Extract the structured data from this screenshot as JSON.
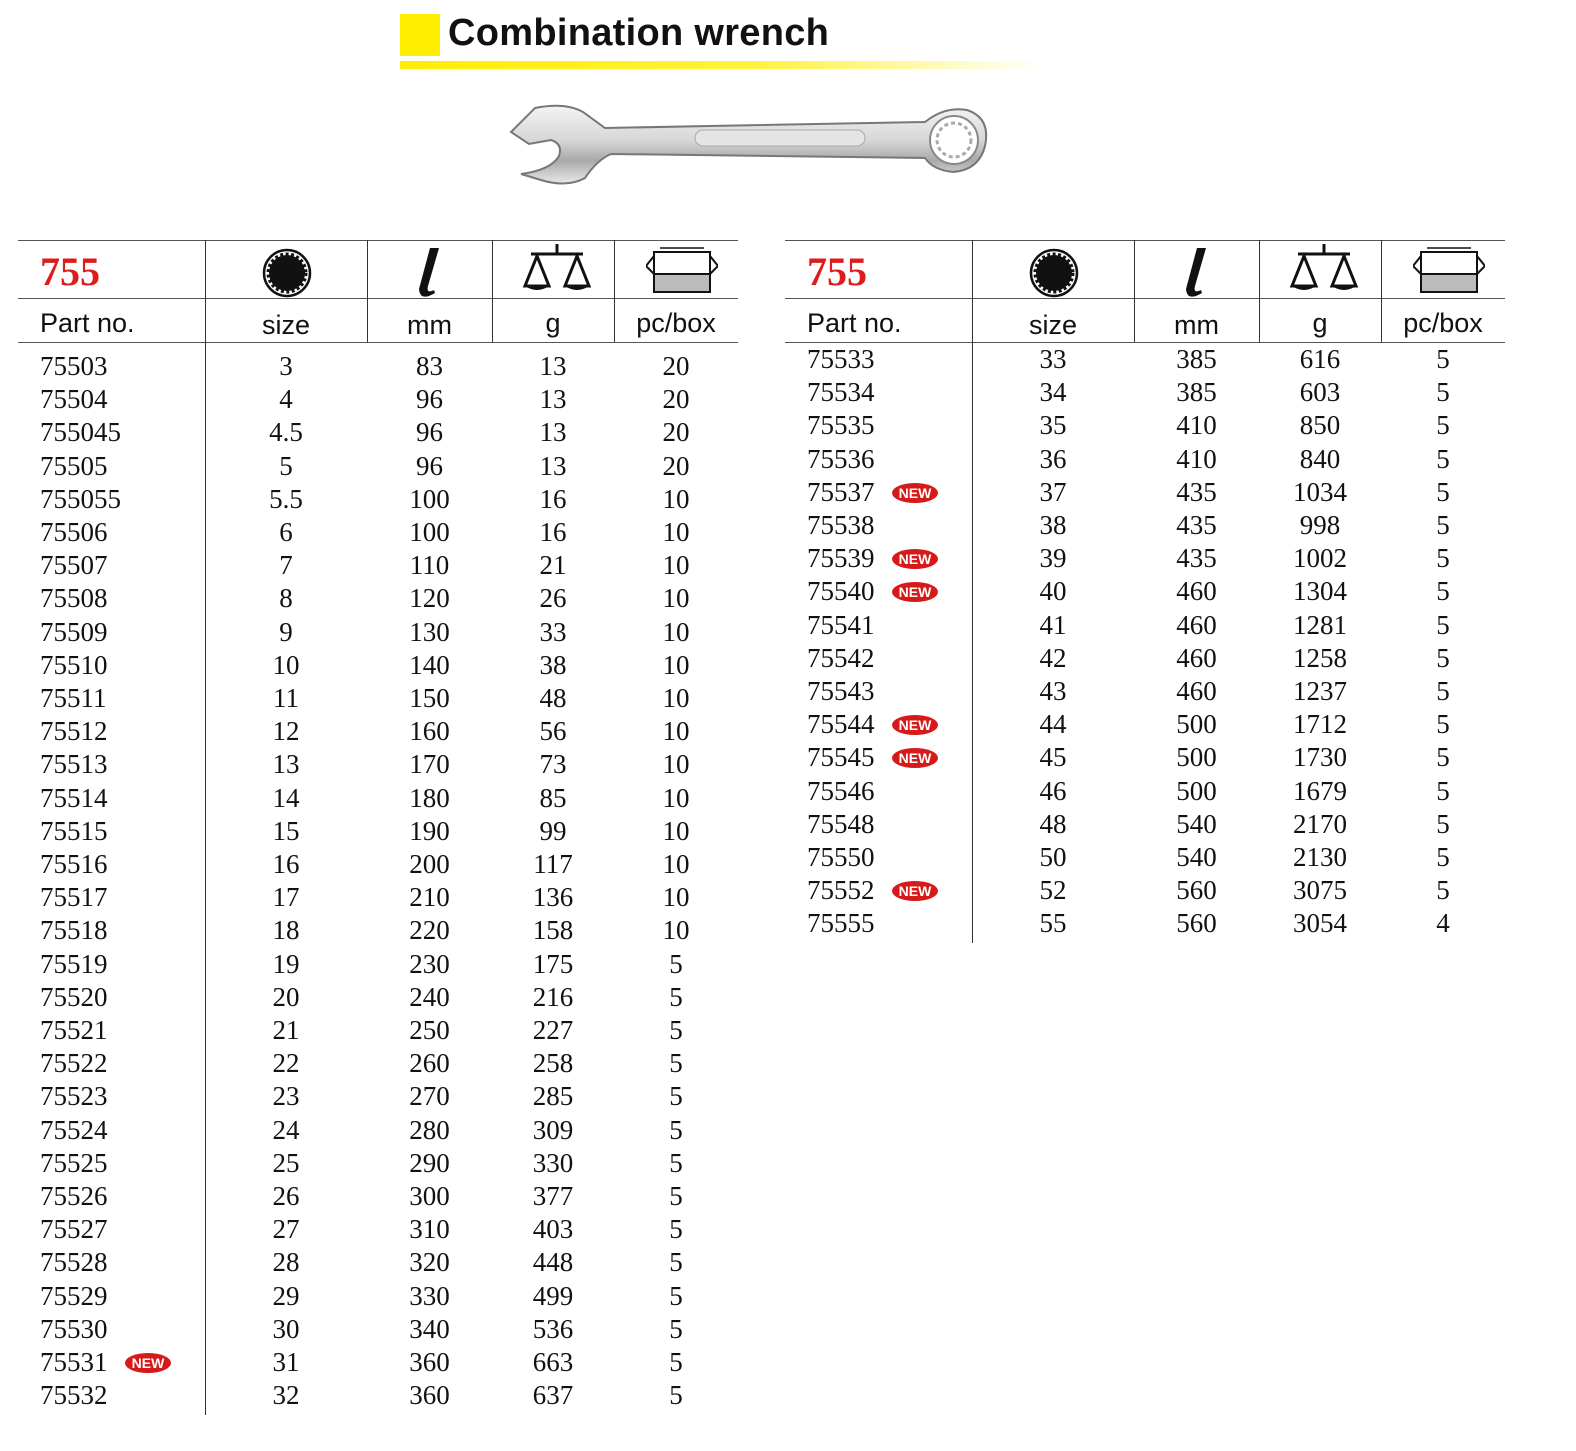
{
  "title": "Combination wrench",
  "series": "755",
  "icons": [
    "twelve-point-ring-icon",
    "length-icon",
    "scale-icon",
    "box-icon"
  ],
  "headers": {
    "part": "Part no.",
    "size": "size",
    "length": "mm",
    "weight": "g",
    "qty": "pc/box"
  },
  "badge_label": "NEW",
  "colors": {
    "title_square": "#ffee00",
    "series": "#dd1c1c",
    "badge": "#d61a1a"
  },
  "tables": [
    {
      "rows": [
        {
          "part": "75503",
          "size": "3",
          "length": "83",
          "weight": "13",
          "qty": "20",
          "new": false
        },
        {
          "part": "75504",
          "size": "4",
          "length": "96",
          "weight": "13",
          "qty": "20",
          "new": false
        },
        {
          "part": "755045",
          "size": "4.5",
          "length": "96",
          "weight": "13",
          "qty": "20",
          "new": false
        },
        {
          "part": "75505",
          "size": "5",
          "length": "96",
          "weight": "13",
          "qty": "20",
          "new": false
        },
        {
          "part": "755055",
          "size": "5.5",
          "length": "100",
          "weight": "16",
          "qty": "10",
          "new": false
        },
        {
          "part": "75506",
          "size": "6",
          "length": "100",
          "weight": "16",
          "qty": "10",
          "new": false
        },
        {
          "part": "75507",
          "size": "7",
          "length": "110",
          "weight": "21",
          "qty": "10",
          "new": false
        },
        {
          "part": "75508",
          "size": "8",
          "length": "120",
          "weight": "26",
          "qty": "10",
          "new": false
        },
        {
          "part": "75509",
          "size": "9",
          "length": "130",
          "weight": "33",
          "qty": "10",
          "new": false
        },
        {
          "part": "75510",
          "size": "10",
          "length": "140",
          "weight": "38",
          "qty": "10",
          "new": false
        },
        {
          "part": "75511",
          "size": "11",
          "length": "150",
          "weight": "48",
          "qty": "10",
          "new": false
        },
        {
          "part": "75512",
          "size": "12",
          "length": "160",
          "weight": "56",
          "qty": "10",
          "new": false
        },
        {
          "part": "75513",
          "size": "13",
          "length": "170",
          "weight": "73",
          "qty": "10",
          "new": false
        },
        {
          "part": "75514",
          "size": "14",
          "length": "180",
          "weight": "85",
          "qty": "10",
          "new": false
        },
        {
          "part": "75515",
          "size": "15",
          "length": "190",
          "weight": "99",
          "qty": "10",
          "new": false
        },
        {
          "part": "75516",
          "size": "16",
          "length": "200",
          "weight": "117",
          "qty": "10",
          "new": false
        },
        {
          "part": "75517",
          "size": "17",
          "length": "210",
          "weight": "136",
          "qty": "10",
          "new": false
        },
        {
          "part": "75518",
          "size": "18",
          "length": "220",
          "weight": "158",
          "qty": "10",
          "new": false
        },
        {
          "part": "75519",
          "size": "19",
          "length": "230",
          "weight": "175",
          "qty": "5",
          "new": false
        },
        {
          "part": "75520",
          "size": "20",
          "length": "240",
          "weight": "216",
          "qty": "5",
          "new": false
        },
        {
          "part": "75521",
          "size": "21",
          "length": "250",
          "weight": "227",
          "qty": "5",
          "new": false
        },
        {
          "part": "75522",
          "size": "22",
          "length": "260",
          "weight": "258",
          "qty": "5",
          "new": false
        },
        {
          "part": "75523",
          "size": "23",
          "length": "270",
          "weight": "285",
          "qty": "5",
          "new": false
        },
        {
          "part": "75524",
          "size": "24",
          "length": "280",
          "weight": "309",
          "qty": "5",
          "new": false
        },
        {
          "part": "75525",
          "size": "25",
          "length": "290",
          "weight": "330",
          "qty": "5",
          "new": false
        },
        {
          "part": "75526",
          "size": "26",
          "length": "300",
          "weight": "377",
          "qty": "5",
          "new": false
        },
        {
          "part": "75527",
          "size": "27",
          "length": "310",
          "weight": "403",
          "qty": "5",
          "new": false
        },
        {
          "part": "75528",
          "size": "28",
          "length": "320",
          "weight": "448",
          "qty": "5",
          "new": false
        },
        {
          "part": "75529",
          "size": "29",
          "length": "330",
          "weight": "499",
          "qty": "5",
          "new": false
        },
        {
          "part": "75530",
          "size": "30",
          "length": "340",
          "weight": "536",
          "qty": "5",
          "new": false
        },
        {
          "part": "75531",
          "size": "31",
          "length": "360",
          "weight": "663",
          "qty": "5",
          "new": true
        },
        {
          "part": "75532",
          "size": "32",
          "length": "360",
          "weight": "637",
          "qty": "5",
          "new": false
        }
      ]
    },
    {
      "rows": [
        {
          "part": "75533",
          "size": "33",
          "length": "385",
          "weight": "616",
          "qty": "5",
          "new": false
        },
        {
          "part": "75534",
          "size": "34",
          "length": "385",
          "weight": "603",
          "qty": "5",
          "new": false
        },
        {
          "part": "75535",
          "size": "35",
          "length": "410",
          "weight": "850",
          "qty": "5",
          "new": false
        },
        {
          "part": "75536",
          "size": "36",
          "length": "410",
          "weight": "840",
          "qty": "5",
          "new": false
        },
        {
          "part": "75537",
          "size": "37",
          "length": "435",
          "weight": "1034",
          "qty": "5",
          "new": true
        },
        {
          "part": "75538",
          "size": "38",
          "length": "435",
          "weight": "998",
          "qty": "5",
          "new": false
        },
        {
          "part": "75539",
          "size": "39",
          "length": "435",
          "weight": "1002",
          "qty": "5",
          "new": true
        },
        {
          "part": "75540",
          "size": "40",
          "length": "460",
          "weight": "1304",
          "qty": "5",
          "new": true
        },
        {
          "part": "75541",
          "size": "41",
          "length": "460",
          "weight": "1281",
          "qty": "5",
          "new": false
        },
        {
          "part": "75542",
          "size": "42",
          "length": "460",
          "weight": "1258",
          "qty": "5",
          "new": false
        },
        {
          "part": "75543",
          "size": "43",
          "length": "460",
          "weight": "1237",
          "qty": "5",
          "new": false
        },
        {
          "part": "75544",
          "size": "44",
          "length": "500",
          "weight": "1712",
          "qty": "5",
          "new": true
        },
        {
          "part": "75545",
          "size": "45",
          "length": "500",
          "weight": "1730",
          "qty": "5",
          "new": true
        },
        {
          "part": "75546",
          "size": "46",
          "length": "500",
          "weight": "1679",
          "qty": "5",
          "new": false
        },
        {
          "part": "75548",
          "size": "48",
          "length": "540",
          "weight": "2170",
          "qty": "5",
          "new": false
        },
        {
          "part": "75550",
          "size": "50",
          "length": "540",
          "weight": "2130",
          "qty": "5",
          "new": false
        },
        {
          "part": "75552",
          "size": "52",
          "length": "560",
          "weight": "3075",
          "qty": "5",
          "new": true
        },
        {
          "part": "75555",
          "size": "55",
          "length": "560",
          "weight": "3054",
          "qty": "4",
          "new": false
        }
      ]
    }
  ]
}
